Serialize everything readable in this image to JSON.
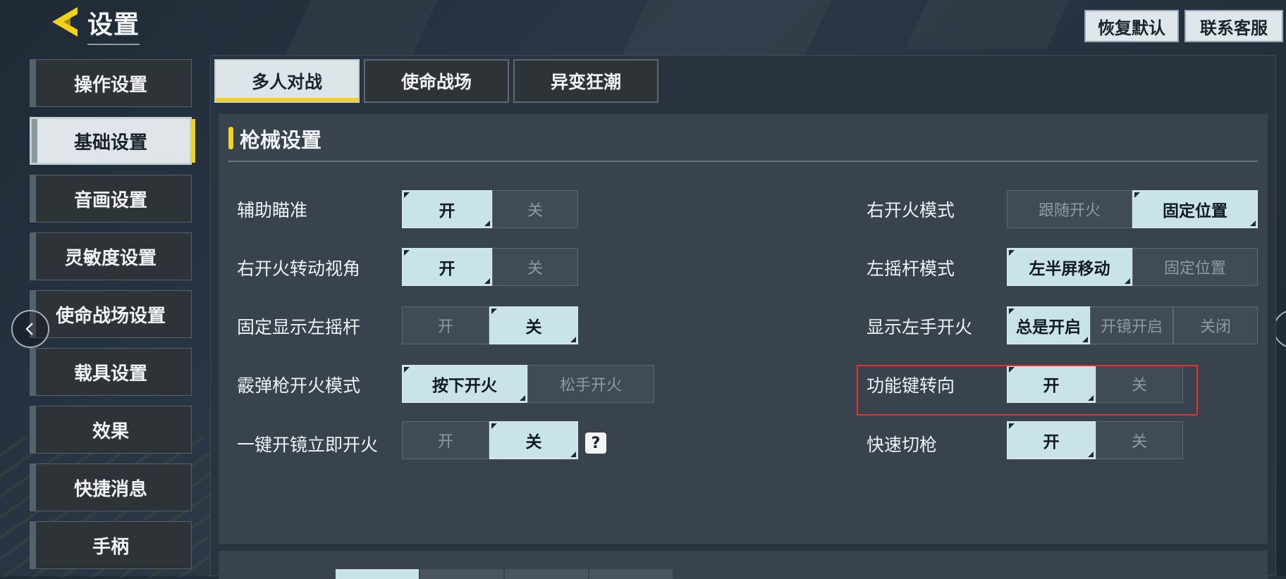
{
  "header": {
    "title": "设置",
    "reset_label": "恢复默认",
    "support_label": "联系客服"
  },
  "sidebar": {
    "items": [
      {
        "label": "操作设置",
        "active": false
      },
      {
        "label": "基础设置",
        "active": true
      },
      {
        "label": "音画设置",
        "active": false
      },
      {
        "label": "灵敏度设置",
        "active": false
      },
      {
        "label": "使命战场设置",
        "active": false
      },
      {
        "label": "载具设置",
        "active": false
      },
      {
        "label": "效果",
        "active": false
      },
      {
        "label": "快捷消息",
        "active": false
      },
      {
        "label": "手柄",
        "active": false
      }
    ]
  },
  "tabs": [
    {
      "label": "多人对战",
      "active": true
    },
    {
      "label": "使命战场",
      "active": false
    },
    {
      "label": "异变狂潮",
      "active": false
    }
  ],
  "section": {
    "title": "枪械设置"
  },
  "left_settings": [
    {
      "label": "辅助瞄准",
      "options": [
        "开",
        "关"
      ],
      "selected": 0
    },
    {
      "label": "右开火转动视角",
      "options": [
        "开",
        "关"
      ],
      "selected": 0
    },
    {
      "label": "固定显示左摇杆",
      "options": [
        "开",
        "关"
      ],
      "selected": 1
    },
    {
      "label": "霰弹枪开火模式",
      "options": [
        "按下开火",
        "松手开火"
      ],
      "selected": 0
    },
    {
      "label": "一键开镜立即开火",
      "options": [
        "开",
        "关"
      ],
      "selected": 1,
      "help": "?"
    }
  ],
  "right_settings": [
    {
      "label": "右开火模式",
      "options": [
        "跟随开火",
        "固定位置"
      ],
      "selected": 1
    },
    {
      "label": "左摇杆模式",
      "options": [
        "左半屏移动",
        "固定位置"
      ],
      "selected": 0
    },
    {
      "label": "显示左手开火",
      "options": [
        "总是开启",
        "开镜开启",
        "关闭"
      ],
      "selected": 0
    },
    {
      "label": "功能键转向",
      "options": [
        "开",
        "关"
      ],
      "selected": 0,
      "highlighted": true
    },
    {
      "label": "快速切枪",
      "options": [
        "开",
        "关"
      ],
      "selected": 0
    }
  ],
  "colors": {
    "accent": "#f2d21a",
    "selected_option": "#c8e4e8",
    "highlight_box": "#e33232"
  },
  "icons": {
    "back": "back-chevron-icon",
    "nav_left": "chevron-left-icon",
    "help": "help-icon"
  }
}
